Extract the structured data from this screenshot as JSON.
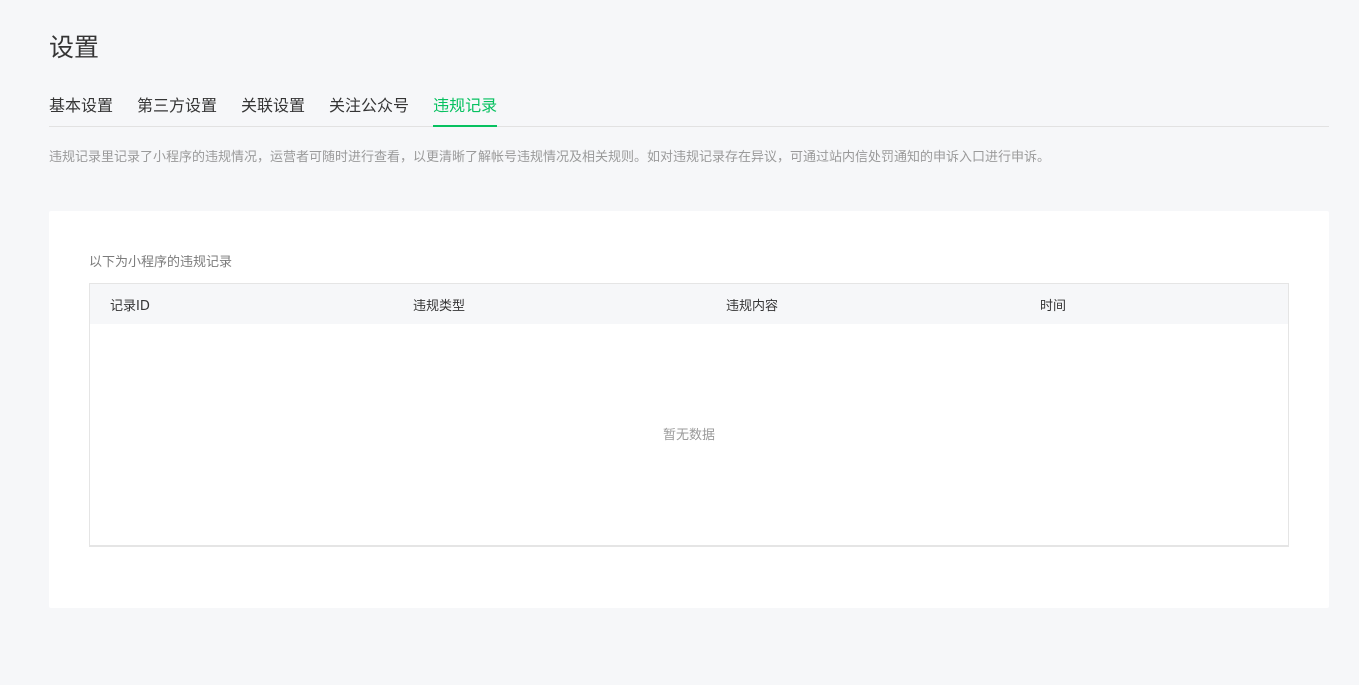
{
  "page": {
    "title": "设置"
  },
  "tabs": [
    {
      "label": "基本设置",
      "active": false
    },
    {
      "label": "第三方设置",
      "active": false
    },
    {
      "label": "关联设置",
      "active": false
    },
    {
      "label": "关注公众号",
      "active": false
    },
    {
      "label": "违规记录",
      "active": true
    }
  ],
  "description": "违规记录里记录了小程序的违规情况，运营者可随时进行查看，以更清晰了解帐号违规情况及相关规则。如对违规记录存在异议，可通过站内信处罚通知的申诉入口进行申诉。",
  "records": {
    "caption": "以下为小程序的违规记录",
    "columns": [
      "记录ID",
      "违规类型",
      "违规内容",
      "时间"
    ],
    "rows": [],
    "empty_text": "暂无数据"
  },
  "colors": {
    "accent": "#07c160",
    "background": "#f6f7f9",
    "text": "#353535",
    "muted": "#9a9a9a"
  }
}
